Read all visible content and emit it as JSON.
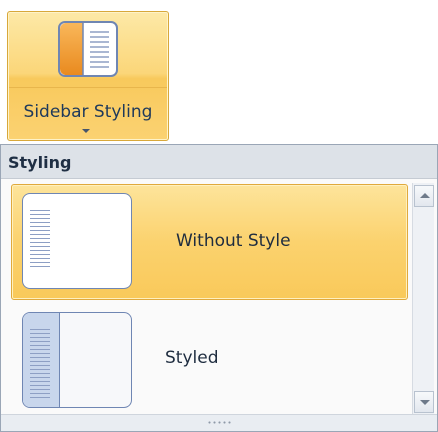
{
  "ribbon_button": {
    "label": "Sidebar Styling",
    "icon": "sidebar-layout-icon",
    "accent_color": "#f6b94b"
  },
  "dropdown": {
    "section_title": "Styling",
    "items": [
      {
        "label": "Without Style",
        "icon": "plain-sidebar-thumbnail-icon",
        "selected": true
      },
      {
        "label": "Styled",
        "icon": "styled-sidebar-thumbnail-icon",
        "selected": false
      }
    ]
  },
  "colors": {
    "hover_highlight": "#fbd26e",
    "thumbnail_border": "#6f86b3",
    "sidebar_fill": "#c8d6ec"
  }
}
